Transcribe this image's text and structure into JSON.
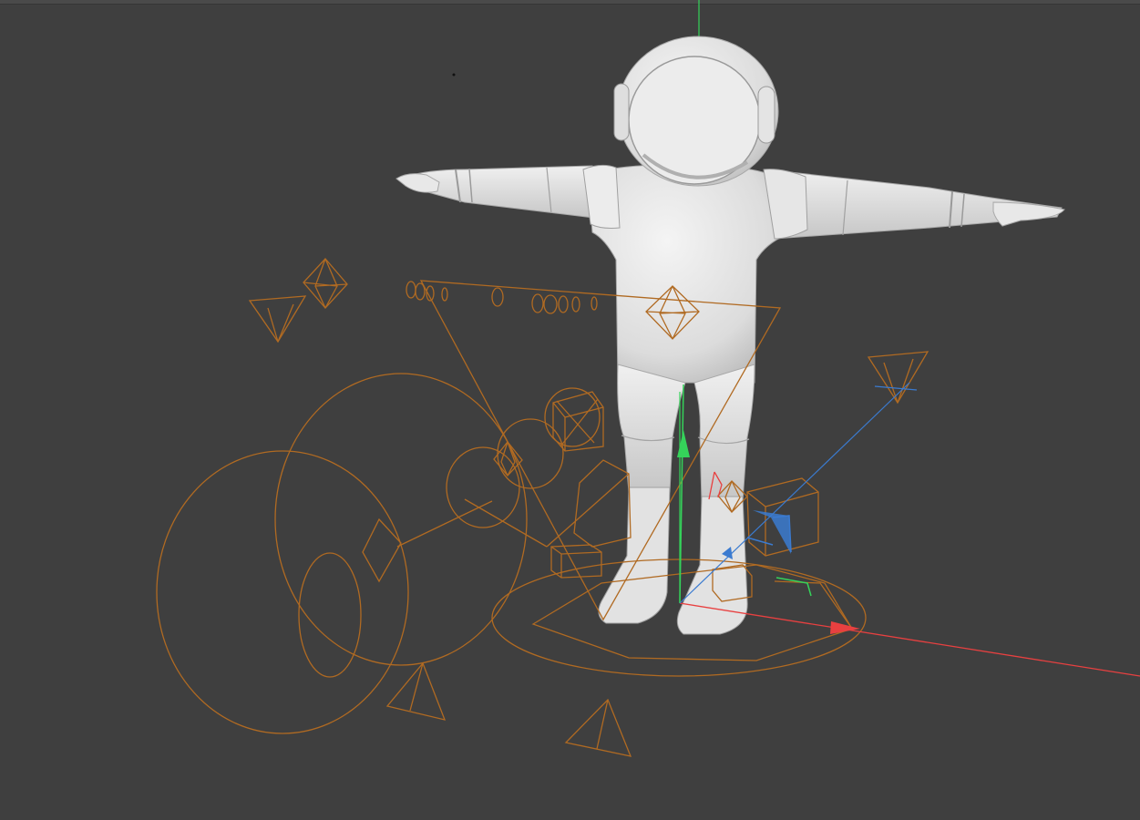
{
  "viewport": {
    "background": "#3f3f3f",
    "rig_color": "#b06a22",
    "model_color": "#e6e6e6",
    "axis_colors": {
      "x": "#e84040",
      "y": "#35d35a",
      "z": "#3b7bd0"
    }
  },
  "scene": {
    "model": "astronaut",
    "pose": "t-pose",
    "selected_object": "rig-controls",
    "gizmo": "move",
    "icons": [
      "octahedron-joint-icon",
      "cone-icon",
      "box-control-icon",
      "circle-control-icon"
    ]
  }
}
